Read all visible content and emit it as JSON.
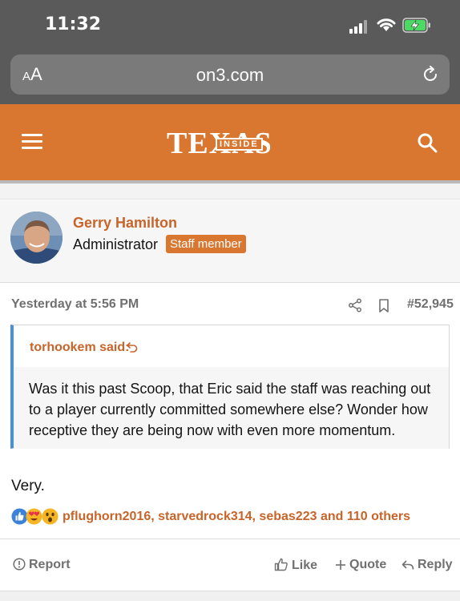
{
  "status_bar": {
    "time": "11:32"
  },
  "browser": {
    "text_size_label": "AA",
    "url": "on3.com"
  },
  "site": {
    "logo_text": "TEXAS",
    "logo_sub": "INSIDE",
    "brand_color": "#d9762f"
  },
  "post": {
    "author": "Gerry Hamilton",
    "role": "Administrator",
    "badge": "Staff member",
    "date": "Yesterday at 5:56 PM",
    "number": "#52,945",
    "quote": {
      "author_label": "torhookem said:",
      "text": "Was it this past Scoop, that Eric said the staff was reaching out to a player currently committed somewhere else? Wonder how receptive they are being now with even more momentum."
    },
    "body": "Very.",
    "reactions": {
      "icons": [
        "like-reaction",
        "love-reaction",
        "wow-reaction"
      ],
      "users": "pflughorn2016, starvedrock314, sebas223 and 110 others"
    },
    "actions": {
      "report": "Report",
      "like": "Like",
      "quote": "Quote",
      "reply": "Reply"
    }
  }
}
